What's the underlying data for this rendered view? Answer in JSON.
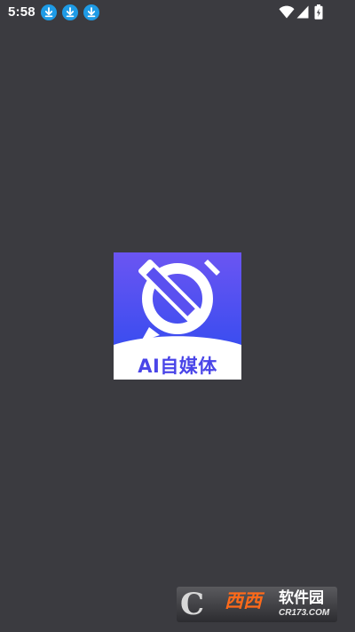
{
  "status_bar": {
    "time": "5:58",
    "notification_icons": [
      "download-icon",
      "download-icon",
      "download-icon"
    ],
    "system_icons": [
      "wifi-icon",
      "signal-icon",
      "battery-icon"
    ]
  },
  "app_logo": {
    "caption": "AI自媒体",
    "icon": "pen-icon",
    "colors": {
      "gradient_top": "#6b55f2",
      "gradient_bottom": "#3b4df0",
      "caption": "#4a45e8"
    }
  },
  "watermark": {
    "logo_letter": "C",
    "brand": "西西",
    "title": "软件园",
    "domain": "CR173.COM"
  },
  "colors": {
    "background": "#3b3b40",
    "status_text": "#ffffff",
    "notification_accent": "#1e9be6"
  }
}
